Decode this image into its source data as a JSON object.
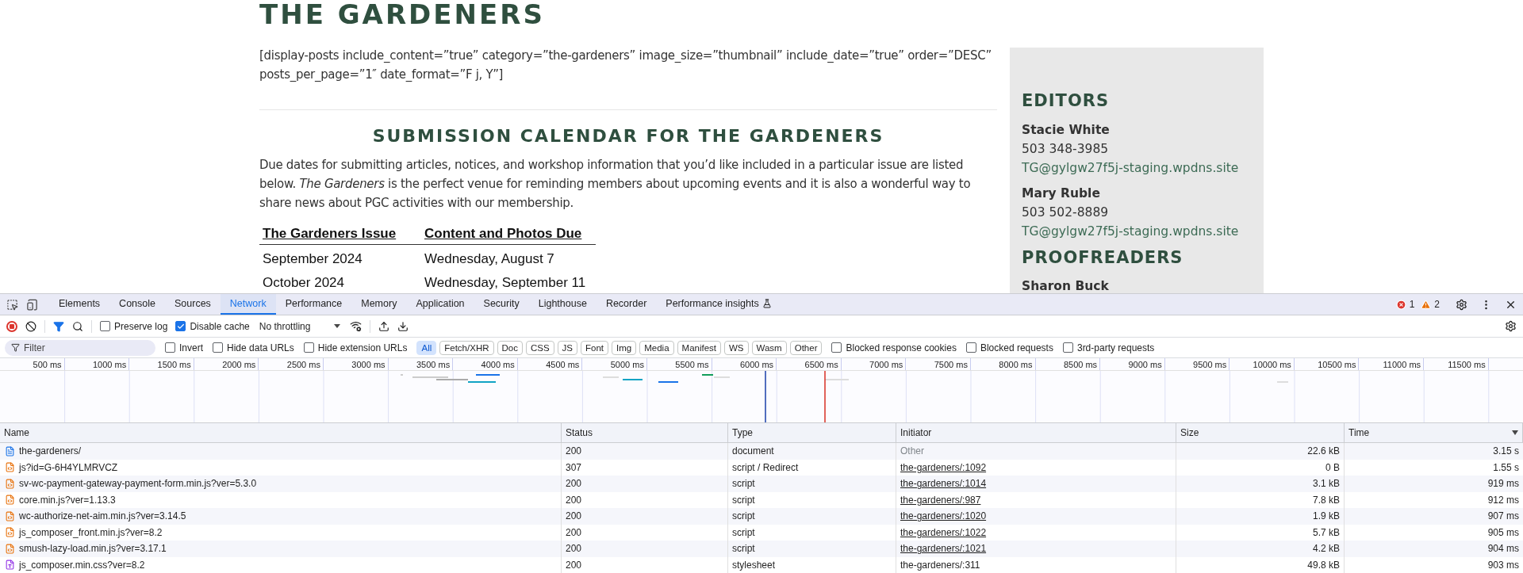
{
  "page": {
    "title": "THE GARDENERS",
    "shortcode": "[display-posts include_content=”true” category=”the-gardeners” image_size=”thumbnail” include_date=”true” order=”DESC” posts_per_page=”1″ date_format=”F j, Y”]",
    "section_heading": "SUBMISSION CALENDAR FOR THE GARDENERS",
    "intro": "Due dates for submitting articles, notices, and workshop information that you’d like included in a particular issue are listed below. *The Gardeners* is the perfect venue for reminding members about upcoming events and it is also a wonderful way to share news about PGC activities with our membership.",
    "schedule": {
      "columns": [
        "The Gardeners Issue",
        "Content and Photos Due"
      ],
      "rows": [
        [
          "September 2024",
          "Wednesday, August 7"
        ],
        [
          "October 2024",
          "Wednesday, September 11"
        ]
      ]
    }
  },
  "sidebar": {
    "sections": [
      {
        "heading": "EDITORS",
        "people": [
          {
            "name": "Stacie White",
            "phone": "503 348-3985",
            "email": "TG@gylgw27f5j-staging.wpdns.site"
          },
          {
            "name": "Mary Ruble",
            "phone": "503 502-8889",
            "email": "TG@gylgw27f5j-staging.wpdns.site"
          }
        ]
      },
      {
        "heading": "PROOFREADERS",
        "people": [
          {
            "name": "Sharon Buck"
          }
        ]
      }
    ]
  },
  "devtools": {
    "tabs": [
      {
        "label": "Elements",
        "selected": false,
        "experimental": false
      },
      {
        "label": "Console",
        "selected": false,
        "experimental": false
      },
      {
        "label": "Sources",
        "selected": false,
        "experimental": false
      },
      {
        "label": "Network",
        "selected": true,
        "experimental": false
      },
      {
        "label": "Performance",
        "selected": false,
        "experimental": false
      },
      {
        "label": "Memory",
        "selected": false,
        "experimental": false
      },
      {
        "label": "Application",
        "selected": false,
        "experimental": false
      },
      {
        "label": "Security",
        "selected": false,
        "experimental": false
      },
      {
        "label": "Lighthouse",
        "selected": false,
        "experimental": false
      },
      {
        "label": "Recorder",
        "selected": false,
        "experimental": false
      },
      {
        "label": "Performance insights",
        "selected": false,
        "experimental": true
      }
    ],
    "issues": {
      "errors": "1",
      "warnings": "2"
    },
    "toolbar": {
      "recording": true,
      "options": [
        {
          "label": "Preserve log",
          "checked": false
        },
        {
          "label": "Disable cache",
          "checked": true
        }
      ],
      "throttling": "No throttling"
    },
    "filter": {
      "placeholder": "Filter",
      "options": [
        {
          "label": "Invert",
          "checked": false
        },
        {
          "label": "Hide data URLs",
          "checked": false
        },
        {
          "label": "Hide extension URLs",
          "checked": false
        }
      ],
      "types": [
        {
          "label": "All",
          "selected": true
        },
        {
          "label": "Fetch/XHR",
          "selected": false
        },
        {
          "label": "Doc",
          "selected": false
        },
        {
          "label": "CSS",
          "selected": false
        },
        {
          "label": "JS",
          "selected": false
        },
        {
          "label": "Font",
          "selected": false
        },
        {
          "label": "Img",
          "selected": false
        },
        {
          "label": "Media",
          "selected": false
        },
        {
          "label": "Manifest",
          "selected": false
        },
        {
          "label": "WS",
          "selected": false
        },
        {
          "label": "Wasm",
          "selected": false
        },
        {
          "label": "Other",
          "selected": false
        }
      ],
      "extra_options": [
        {
          "label": "Blocked response cookies",
          "checked": false
        },
        {
          "label": "Blocked requests",
          "checked": false
        },
        {
          "label": "3rd-party requests",
          "checked": false
        }
      ]
    },
    "timeline": {
      "ticks": [
        "500 ms",
        "1000 ms",
        "1500 ms",
        "2000 ms",
        "2500 ms",
        "3000 ms",
        "3500 ms",
        "4000 ms",
        "4500 ms",
        "5000 ms",
        "5500 ms",
        "6000 ms",
        "6500 ms",
        "7000 ms",
        "7500 ms",
        "8000 ms",
        "8500 ms",
        "9000 ms",
        "9500 ms",
        "10000 ms",
        "10500 ms",
        "11000 ms",
        "11500 ms"
      ]
    },
    "table": {
      "columns": [
        {
          "label": "Name",
          "sorted": false
        },
        {
          "label": "Status",
          "sorted": false
        },
        {
          "label": "Type",
          "sorted": false
        },
        {
          "label": "Initiator",
          "sorted": false
        },
        {
          "label": "Size",
          "sorted": false
        },
        {
          "label": "Time",
          "sorted": true
        }
      ],
      "rows": [
        {
          "kind": "document",
          "name": "the-gardeners/",
          "status": "200",
          "type": "document",
          "initiator": "Other",
          "underlined": false,
          "size": "22.6 kB",
          "time": "3.15 s"
        },
        {
          "kind": "script",
          "name": "js?id=G-6H4YLMRVCZ",
          "status": "307",
          "type": "script / Redirect",
          "initiator": "the-gardeners/:1092",
          "underlined": true,
          "size": "0 B",
          "time": "1.55 s"
        },
        {
          "kind": "script",
          "name": "sv-wc-payment-gateway-payment-form.min.js?ver=5.3.0",
          "status": "200",
          "type": "script",
          "initiator": "the-gardeners/:1014",
          "underlined": true,
          "size": "3.1 kB",
          "time": "919 ms"
        },
        {
          "kind": "script",
          "name": "core.min.js?ver=1.13.3",
          "status": "200",
          "type": "script",
          "initiator": "the-gardeners/:987",
          "underlined": true,
          "size": "7.8 kB",
          "time": "912 ms"
        },
        {
          "kind": "script",
          "name": "wc-authorize-net-aim.min.js?ver=3.14.5",
          "status": "200",
          "type": "script",
          "initiator": "the-gardeners/:1020",
          "underlined": true,
          "size": "1.9 kB",
          "time": "907 ms"
        },
        {
          "kind": "script",
          "name": "js_composer_front.min.js?ver=8.2",
          "status": "200",
          "type": "script",
          "initiator": "the-gardeners/:1022",
          "underlined": true,
          "size": "5.7 kB",
          "time": "905 ms"
        },
        {
          "kind": "script",
          "name": "smush-lazy-load.min.js?ver=3.17.1",
          "status": "200",
          "type": "script",
          "initiator": "the-gardeners/:1021",
          "underlined": true,
          "size": "4.2 kB",
          "time": "904 ms"
        },
        {
          "kind": "stylesheet",
          "name": "js_composer.min.css?ver=8.2",
          "status": "200",
          "type": "stylesheet",
          "initiator": "the-gardeners/:311",
          "underlined": false,
          "size": "49.8 kB",
          "time": "903 ms"
        }
      ]
    }
  }
}
